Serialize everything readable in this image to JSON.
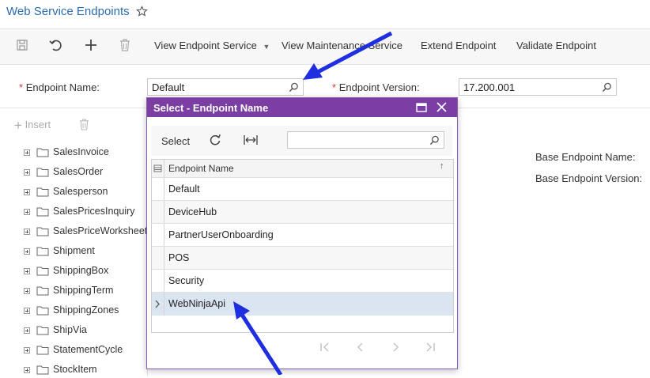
{
  "header": {
    "title": "Web Service Endpoints",
    "star_icon": "star-icon"
  },
  "toolbar": {
    "buttons": [
      {
        "label": "View Endpoint Service"
      },
      {
        "label": "View Maintenance Service"
      },
      {
        "label": "Extend Endpoint"
      },
      {
        "label": "Validate Endpoint"
      }
    ]
  },
  "form": {
    "required_mark": "*",
    "endpoint_name_label": "Endpoint Name:",
    "endpoint_name_value": "Default",
    "endpoint_version_label": "Endpoint Version:",
    "endpoint_version_value": "17.200.001"
  },
  "left_panel": {
    "insert_label": "Insert",
    "tree": [
      "SalesInvoice",
      "SalesOrder",
      "Salesperson",
      "SalesPricesInquiry",
      "SalesPriceWorksheet",
      "Shipment",
      "ShippingBox",
      "ShippingTerm",
      "ShippingZones",
      "ShipVia",
      "StatementCycle",
      "StockItem"
    ]
  },
  "right_panel": {
    "base_endpoint_name_label": "Base Endpoint Name:",
    "base_endpoint_version_label": "Base Endpoint Version:"
  },
  "dialog": {
    "title": "Select - Endpoint Name",
    "select_label": "Select",
    "search_value": "",
    "column_header": "Endpoint Name",
    "rows": [
      "Default",
      "DeviceHub",
      "PartnerUserOnboarding",
      "POS",
      "Security",
      "WebNinjaApi"
    ],
    "selected_row": 5
  },
  "colors": {
    "accent": "#7b3fa3",
    "link": "#2b6cb0",
    "selected_row": "#dbe5f1",
    "arrow": "#1f2fe0"
  }
}
